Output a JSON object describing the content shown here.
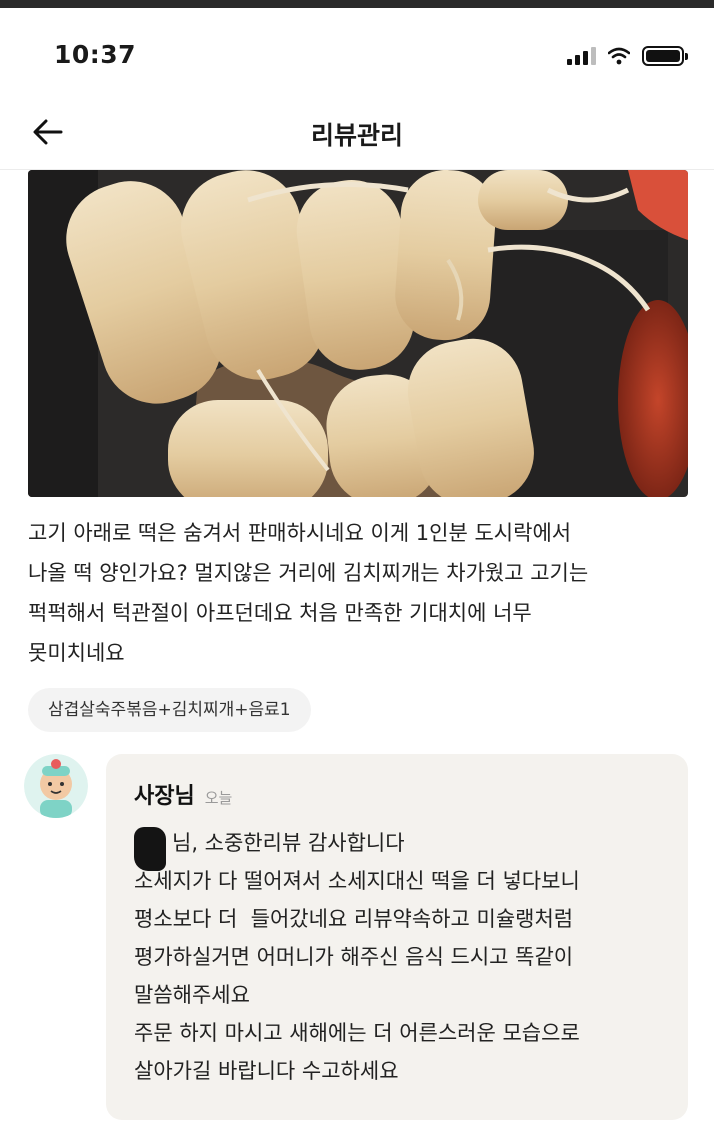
{
  "status_bar": {
    "time": "10:37",
    "icons": [
      "cellular-signal-icon",
      "wifi-icon",
      "battery-icon"
    ]
  },
  "nav": {
    "title": "리뷰관리",
    "back_icon": "arrow-left-icon"
  },
  "review": {
    "photo": "photo of tteok rice cakes and pork in a takeout container",
    "text_lines": [
      "고기 아래로 떡은 숨겨서 판매하시네요 이게 1인분 도시락에서",
      "나올 떡 양인가요? 멀지않은 거리에 김치찌개는 차가웠고 고기는",
      "퍽퍽해서 턱관절이 아프던데요 처음 만족한 기대치에 너무",
      "못미치네요"
    ],
    "menu_tag": "삼겹살숙주볶음+김치찌개+음료1"
  },
  "reply": {
    "author": "사장님",
    "date": "오늘",
    "lines": [
      "님, 소중한리뷰 감사합니다",
      "소세지가 다 떨어져서 소세지대신 떡을 더 넣다보니",
      "평소보다 더  들어갔네요 리뷰약속하고 미슐랭처럼",
      "평가하실거면 어머니가 해주신 음식 드시고 똑같이",
      "말씀해주세요",
      "주문 하지 마시고 새해에는 더 어른스러운 모습으로",
      "살아가길 바랍니다 수고하세요"
    ]
  },
  "colors": {
    "reply_card_bg": "#f4f2ee",
    "tag_bg": "#f3f3f3",
    "muted_text": "#9a9a9a"
  }
}
